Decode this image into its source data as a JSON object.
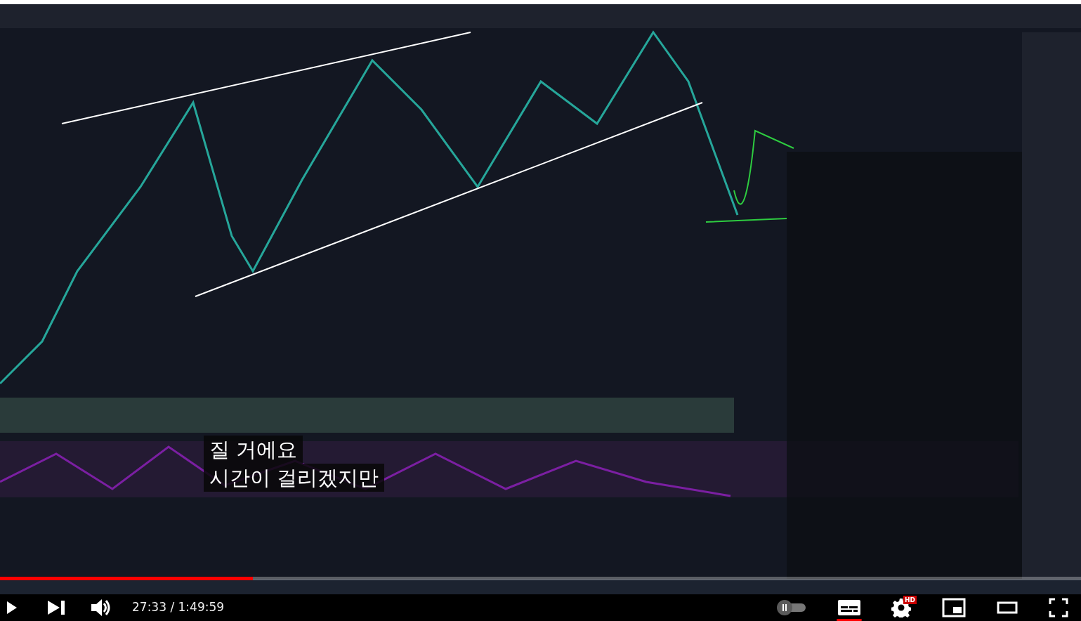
{
  "captions": [
    {
      "text": "질 거에요"
    },
    {
      "text": "시간이 걸리겠지만"
    }
  ],
  "progress": {
    "level": 0.234
  },
  "time": "27:33 / 1:49:59",
  "autoplay": {
    "on": false
  },
  "subtitles": {
    "on": true
  },
  "settings": {
    "badge": "HD"
  }
}
